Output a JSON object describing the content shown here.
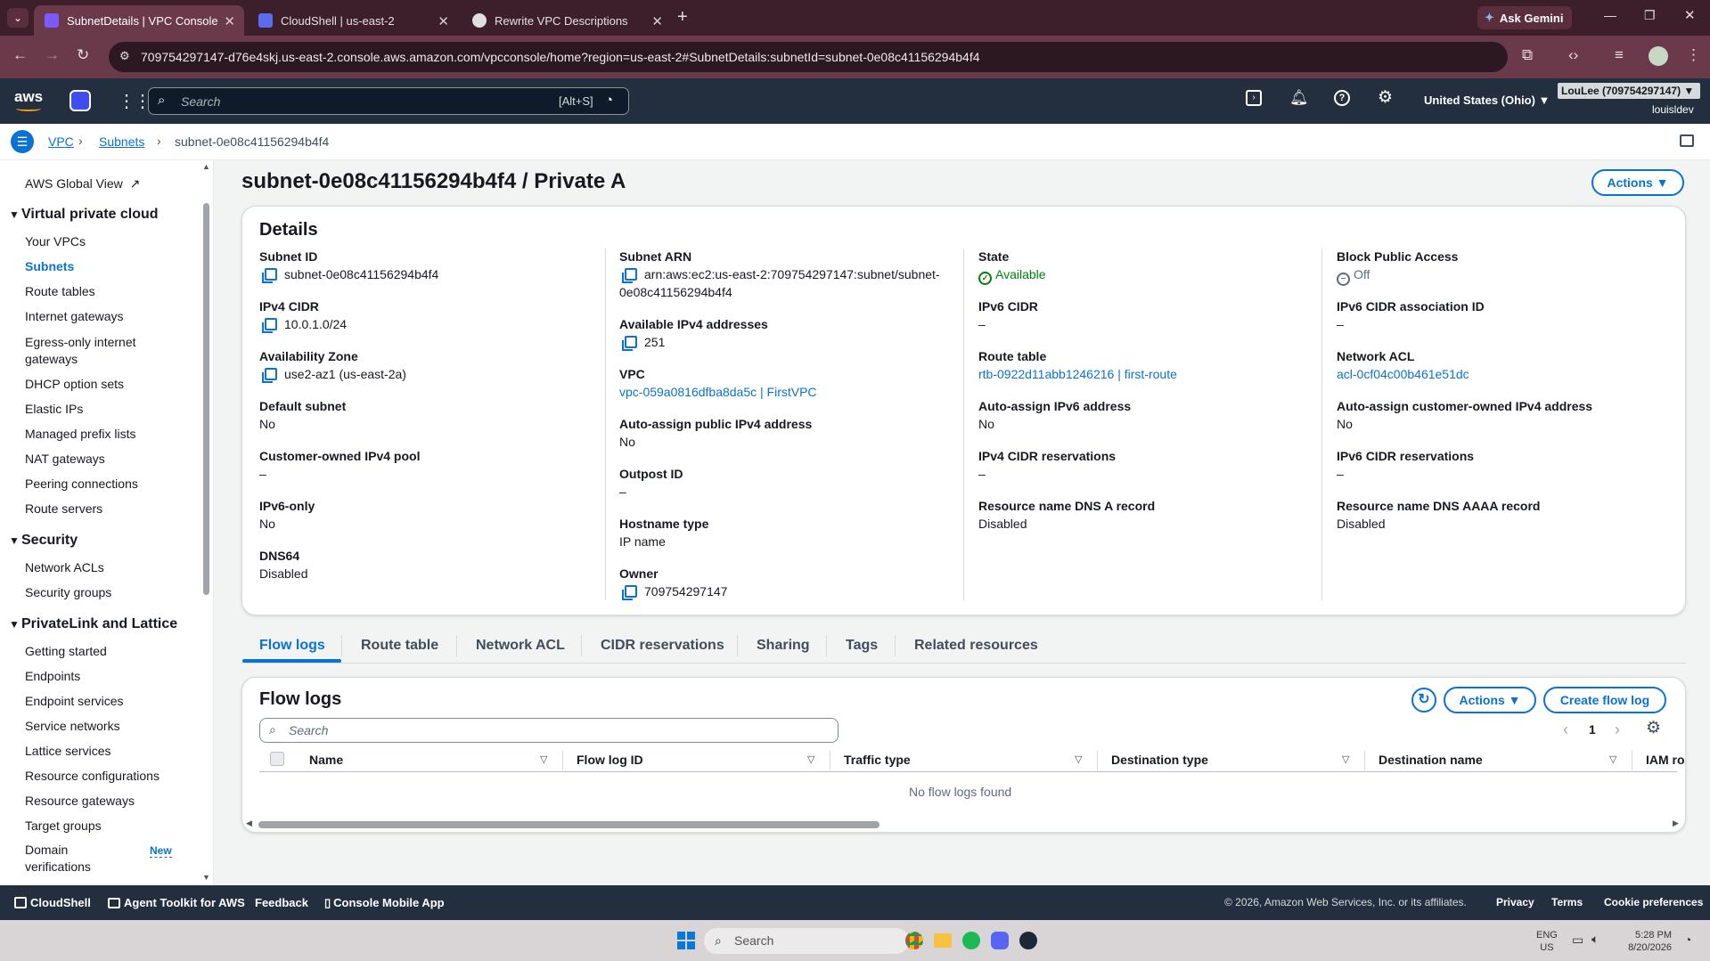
{
  "browser": {
    "tabs": [
      {
        "label": "SubnetDetails | VPC Console",
        "color": "#7a5af8"
      },
      {
        "label": "CloudShell | us-east-2",
        "color": "#5b6cf0"
      },
      {
        "label": "Rewrite VPC Descriptions",
        "color": "#e0e0e0"
      }
    ],
    "url": "709754297147-d76e4skj.us-east-2.console.aws.amazon.com/vpcconsole/home?region=us-east-2#SubnetDetails:subnetId=subnet-0e08c41156294b4f4",
    "gemini_label": "Ask Gemini"
  },
  "aws": {
    "logo": "aws",
    "search_placeholder": "Search",
    "search_shortcut": "[Alt+S]",
    "region": "United States (Ohio) ▼",
    "account": "LouLee (709754297147) ▼",
    "user": "louisldev"
  },
  "breadcrumb": {
    "items": [
      "VPC",
      "Subnets"
    ],
    "current": "subnet-0e08c41156294b4f4"
  },
  "sidebar": {
    "global_view": "AWS Global View",
    "sections": [
      {
        "title": "Virtual private cloud",
        "items": [
          "Your VPCs",
          "Subnets",
          "Route tables",
          "Internet gateways",
          "Egress-only internet gateways",
          "DHCP option sets",
          "Elastic IPs",
          "Managed prefix lists",
          "NAT gateways",
          "Peering connections",
          "Route servers"
        ]
      },
      {
        "title": "Security",
        "items": [
          "Network ACLs",
          "Security groups"
        ]
      },
      {
        "title": "PrivateLink and Lattice",
        "items": [
          "Getting started",
          "Endpoints",
          "Endpoint services",
          "Service networks",
          "Lattice services",
          "Resource configurations",
          "Resource gateways",
          "Target groups",
          "Domain verifications"
        ]
      }
    ],
    "new_badge": "New"
  },
  "page": {
    "title": "subnet-0e08c41156294b4f4 / Private A",
    "actions": "Actions ▼",
    "details_title": "Details",
    "col1": [
      {
        "label": "Subnet ID",
        "value": "subnet-0e08c41156294b4f4"
      },
      {
        "label": "IPv4 CIDR",
        "value": "10.0.1.0/24"
      },
      {
        "label": "Availability Zone",
        "value": "use2-az1 (us-east-2a)"
      },
      {
        "label": "Default subnet",
        "value": "No"
      },
      {
        "label": "Customer-owned IPv4 pool",
        "value": "–"
      },
      {
        "label": "IPv6-only",
        "value": "No"
      },
      {
        "label": "DNS64",
        "value": "Disabled"
      }
    ],
    "col2": [
      {
        "label": "Subnet ARN",
        "value": "arn:aws:ec2:us-east-2:709754297147:subnet/subnet-",
        "value2": "0e08c41156294b4f4"
      },
      {
        "label": "Available IPv4 addresses",
        "value": "251"
      },
      {
        "label": "VPC",
        "value": "vpc-059a0816dfba8da5c | FirstVPC"
      },
      {
        "label": "Auto-assign public IPv4 address",
        "value": "No"
      },
      {
        "label": "Outpost ID",
        "value": "–"
      },
      {
        "label": "Hostname type",
        "value": "IP name"
      },
      {
        "label": "Owner",
        "value": "709754297147"
      }
    ],
    "col3": [
      {
        "label": "State",
        "value": "Available"
      },
      {
        "label": "IPv6 CIDR",
        "value": "–"
      },
      {
        "label": "Route table",
        "value": "rtb-0922d11abb1246216 | first-route"
      },
      {
        "label": "Auto-assign IPv6 address",
        "value": "No"
      },
      {
        "label": "IPv4 CIDR reservations",
        "value": "–"
      },
      {
        "label": "Resource name DNS A record",
        "value": "Disabled"
      }
    ],
    "col4": [
      {
        "label": "Block Public Access",
        "value": "Off"
      },
      {
        "label": "IPv6 CIDR association ID",
        "value": "–"
      },
      {
        "label": "Network ACL",
        "value": "acl-0cf04c00b461e51dc"
      },
      {
        "label": "Auto-assign customer-owned IPv4 address",
        "value": "No"
      },
      {
        "label": "IPv6 CIDR reservations",
        "value": "–"
      },
      {
        "label": "Resource name DNS AAAA record",
        "value": "Disabled"
      }
    ],
    "tabs": [
      "Flow logs",
      "Route table",
      "Network ACL",
      "CIDR reservations",
      "Sharing",
      "Tags",
      "Related resources"
    ],
    "flowlogs": {
      "title": "Flow logs",
      "actions": "Actions ▼",
      "create": "Create flow log",
      "search_placeholder": "Search",
      "page": "1",
      "columns": [
        "Name",
        "Flow log ID",
        "Traffic type",
        "Destination type",
        "Destination name",
        "IAM ro"
      ],
      "empty": "No flow logs found"
    }
  },
  "footer": {
    "cloudshell": "CloudShell",
    "agent": "Agent Toolkit for AWS",
    "feedback": "Feedback",
    "mobile": "Console Mobile App",
    "copyright": "© 2026, Amazon Web Services, Inc. or its affiliates.",
    "privacy": "Privacy",
    "terms": "Terms",
    "cookie": "Cookie preferences"
  },
  "taskbar": {
    "search": "Search",
    "lang1": "ENG",
    "lang2": "US",
    "time": "5:28 PM",
    "date": "8/20/2026"
  },
  "colors": {
    "accent": "#0972d3",
    "navy": "#232f3e",
    "success": "#037f0c"
  }
}
